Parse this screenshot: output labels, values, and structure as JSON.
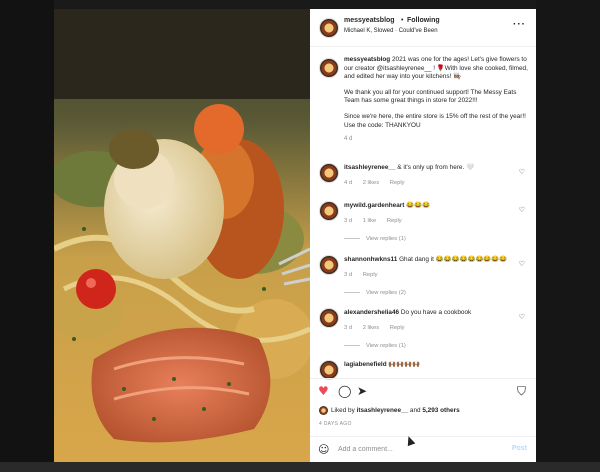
{
  "header": {
    "username": "messyeatsblog",
    "separator": "•",
    "follow_label": "Following",
    "audio_info": "Michael K, Slowed · Could've Been",
    "more_icon": "more-options-icon"
  },
  "caption": {
    "username": "messyeatsblog",
    "paragraphs": [
      "2021 was one for the ages! Let's give flowers to our creator @itsashleyrenee__ ! 🌹With love she cooked, filmed, and edited her way into your kitchens! 👩🏽‍🍳",
      "We thank you all for your continued support! The Messy Eats Team has some great things in store for 2022!!!",
      "Since we're here, the entire store is 15% off the rest of the year!! Use the code: THANKYOU"
    ],
    "time": "4 d"
  },
  "comments": [
    {
      "username": "itsashleyrenee__",
      "text": "& it's only up from here. 🤍",
      "time": "4 d",
      "likes": "2 likes",
      "reply": "Reply",
      "replies": ""
    },
    {
      "username": "mywild.gardenheart",
      "text": "😂😂😂",
      "time": "3 d",
      "likes": "1 like",
      "reply": "Reply",
      "replies": "View replies (1)"
    },
    {
      "username": "shannonhwkns11",
      "text": "Ghat dang it 😂😂😂😂😂😂😂😂😂",
      "time": "3 d",
      "likes": "",
      "reply": "Reply",
      "replies": "View replies (2)"
    },
    {
      "username": "alexandershelia46",
      "text": "Do you have a cookbook",
      "time": "3 d",
      "likes": "2 likes",
      "reply": "Reply",
      "replies": "View replies (1)"
    },
    {
      "username": "lagiabenefield",
      "text": "🙌🏾🙌🏾🙌🏾🙌🏾",
      "time": "",
      "likes": "",
      "reply": "",
      "replies": ""
    }
  ],
  "actions": {
    "like_icon": "heart-filled-icon",
    "comment_icon": "comment-bubble-icon",
    "share_icon": "paper-plane-icon",
    "save_icon": "bookmark-icon"
  },
  "likes": {
    "prefix": "Liked by",
    "user": "itsashleyrenee__",
    "middle": "and",
    "count": "5,293 others"
  },
  "post_time": "4 DAYS AGO",
  "add_comment": {
    "placeholder": "Add a comment...",
    "post_label": "Post",
    "emoji_icon": "emoji-smile-icon"
  },
  "media": {
    "mute_icon": "speaker-muted-icon"
  },
  "colors": {
    "like_red": "#ed4956",
    "post_disabled": "#b3dbff",
    "secondary_text": "#8e8e8e"
  }
}
